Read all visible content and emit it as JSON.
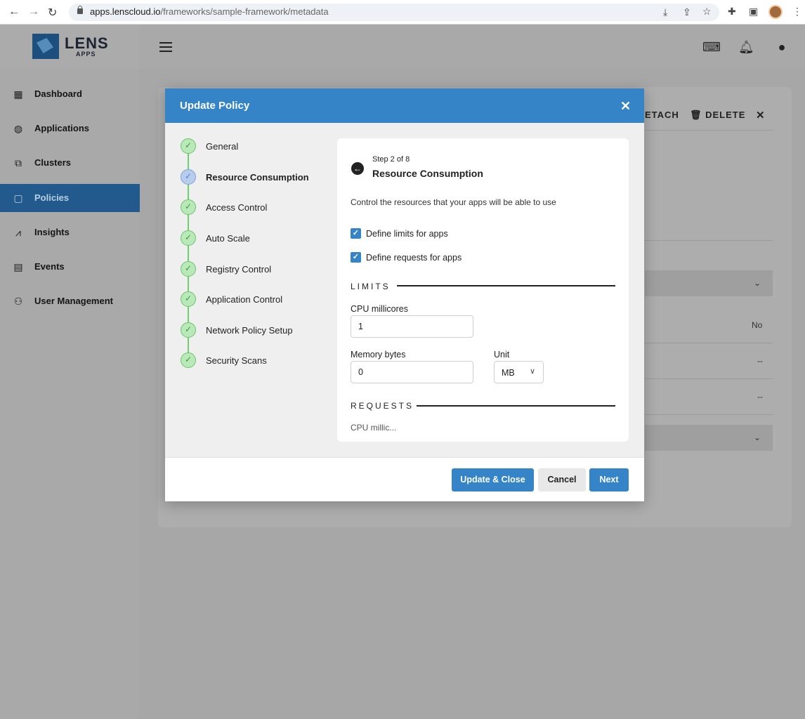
{
  "browser": {
    "url_host": "apps.lenscloud.io",
    "url_path": "/frameworks/sample-framework/metadata"
  },
  "app": {
    "logo_text": "LENS",
    "logo_sub": "APPS"
  },
  "sidebar": {
    "items": [
      {
        "label": "Dashboard",
        "icon": "dashboard-icon",
        "active": false
      },
      {
        "label": "Applications",
        "icon": "applications-icon",
        "active": false
      },
      {
        "label": "Clusters",
        "icon": "clusters-icon",
        "active": false
      },
      {
        "label": "Policies",
        "icon": "policies-icon",
        "active": true
      },
      {
        "label": "Insights",
        "icon": "insights-icon",
        "active": false
      },
      {
        "label": "Events",
        "icon": "events-icon",
        "active": false
      },
      {
        "label": "User Management",
        "icon": "users-icon",
        "active": false
      }
    ]
  },
  "background": {
    "detach_label": "ETACH",
    "delete_label": "DELETE",
    "row_values": [
      "No",
      "--",
      "--"
    ]
  },
  "modal": {
    "title": "Update Policy",
    "steps": [
      {
        "label": "General",
        "state": "done"
      },
      {
        "label": "Resource Consumption",
        "state": "current"
      },
      {
        "label": "Access Control",
        "state": "done"
      },
      {
        "label": "Auto Scale",
        "state": "done"
      },
      {
        "label": "Registry Control",
        "state": "done"
      },
      {
        "label": "Application Control",
        "state": "done"
      },
      {
        "label": "Network Policy Setup",
        "state": "done"
      },
      {
        "label": "Security Scans",
        "state": "done"
      }
    ],
    "panel": {
      "step_count": "Step 2 of 8",
      "title": "Resource Consumption",
      "description": "Control the resources that your apps will be able to use",
      "check_limits": "Define limits for apps",
      "check_requests": "Define requests for apps",
      "limits_header": "LIMITS",
      "cpu_label": "CPU millicores",
      "cpu_value": "1",
      "memory_label": "Memory bytes",
      "memory_value": "0",
      "unit_label": "Unit",
      "unit_value": "MB",
      "requests_header": "REQUESTS",
      "cutoff_text": "CPU millic..."
    },
    "footer": {
      "update_close": "Update & Close",
      "cancel": "Cancel",
      "next": "Next"
    }
  },
  "colors": {
    "primary": "#3584c8",
    "sidebar_active": "#225a8e",
    "step_done": "#6bc46b",
    "step_current": "#7ea2d9"
  }
}
